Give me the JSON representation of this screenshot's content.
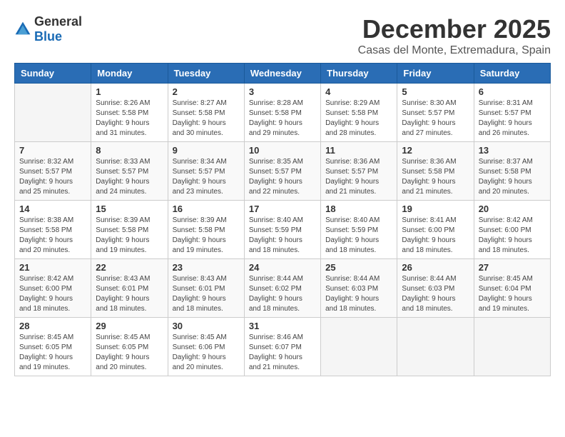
{
  "logo": {
    "general": "General",
    "blue": "Blue"
  },
  "title": "December 2025",
  "subtitle": "Casas del Monte, Extremadura, Spain",
  "headers": [
    "Sunday",
    "Monday",
    "Tuesday",
    "Wednesday",
    "Thursday",
    "Friday",
    "Saturday"
  ],
  "weeks": [
    [
      {
        "day": "",
        "sunrise": "",
        "sunset": "",
        "daylight": ""
      },
      {
        "day": "1",
        "sunrise": "Sunrise: 8:26 AM",
        "sunset": "Sunset: 5:58 PM",
        "daylight": "Daylight: 9 hours and 31 minutes."
      },
      {
        "day": "2",
        "sunrise": "Sunrise: 8:27 AM",
        "sunset": "Sunset: 5:58 PM",
        "daylight": "Daylight: 9 hours and 30 minutes."
      },
      {
        "day": "3",
        "sunrise": "Sunrise: 8:28 AM",
        "sunset": "Sunset: 5:58 PM",
        "daylight": "Daylight: 9 hours and 29 minutes."
      },
      {
        "day": "4",
        "sunrise": "Sunrise: 8:29 AM",
        "sunset": "Sunset: 5:58 PM",
        "daylight": "Daylight: 9 hours and 28 minutes."
      },
      {
        "day": "5",
        "sunrise": "Sunrise: 8:30 AM",
        "sunset": "Sunset: 5:57 PM",
        "daylight": "Daylight: 9 hours and 27 minutes."
      },
      {
        "day": "6",
        "sunrise": "Sunrise: 8:31 AM",
        "sunset": "Sunset: 5:57 PM",
        "daylight": "Daylight: 9 hours and 26 minutes."
      }
    ],
    [
      {
        "day": "7",
        "sunrise": "Sunrise: 8:32 AM",
        "sunset": "Sunset: 5:57 PM",
        "daylight": "Daylight: 9 hours and 25 minutes."
      },
      {
        "day": "8",
        "sunrise": "Sunrise: 8:33 AM",
        "sunset": "Sunset: 5:57 PM",
        "daylight": "Daylight: 9 hours and 24 minutes."
      },
      {
        "day": "9",
        "sunrise": "Sunrise: 8:34 AM",
        "sunset": "Sunset: 5:57 PM",
        "daylight": "Daylight: 9 hours and 23 minutes."
      },
      {
        "day": "10",
        "sunrise": "Sunrise: 8:35 AM",
        "sunset": "Sunset: 5:57 PM",
        "daylight": "Daylight: 9 hours and 22 minutes."
      },
      {
        "day": "11",
        "sunrise": "Sunrise: 8:36 AM",
        "sunset": "Sunset: 5:57 PM",
        "daylight": "Daylight: 9 hours and 21 minutes."
      },
      {
        "day": "12",
        "sunrise": "Sunrise: 8:36 AM",
        "sunset": "Sunset: 5:58 PM",
        "daylight": "Daylight: 9 hours and 21 minutes."
      },
      {
        "day": "13",
        "sunrise": "Sunrise: 8:37 AM",
        "sunset": "Sunset: 5:58 PM",
        "daylight": "Daylight: 9 hours and 20 minutes."
      }
    ],
    [
      {
        "day": "14",
        "sunrise": "Sunrise: 8:38 AM",
        "sunset": "Sunset: 5:58 PM",
        "daylight": "Daylight: 9 hours and 20 minutes."
      },
      {
        "day": "15",
        "sunrise": "Sunrise: 8:39 AM",
        "sunset": "Sunset: 5:58 PM",
        "daylight": "Daylight: 9 hours and 19 minutes."
      },
      {
        "day": "16",
        "sunrise": "Sunrise: 8:39 AM",
        "sunset": "Sunset: 5:58 PM",
        "daylight": "Daylight: 9 hours and 19 minutes."
      },
      {
        "day": "17",
        "sunrise": "Sunrise: 8:40 AM",
        "sunset": "Sunset: 5:59 PM",
        "daylight": "Daylight: 9 hours and 18 minutes."
      },
      {
        "day": "18",
        "sunrise": "Sunrise: 8:40 AM",
        "sunset": "Sunset: 5:59 PM",
        "daylight": "Daylight: 9 hours and 18 minutes."
      },
      {
        "day": "19",
        "sunrise": "Sunrise: 8:41 AM",
        "sunset": "Sunset: 6:00 PM",
        "daylight": "Daylight: 9 hours and 18 minutes."
      },
      {
        "day": "20",
        "sunrise": "Sunrise: 8:42 AM",
        "sunset": "Sunset: 6:00 PM",
        "daylight": "Daylight: 9 hours and 18 minutes."
      }
    ],
    [
      {
        "day": "21",
        "sunrise": "Sunrise: 8:42 AM",
        "sunset": "Sunset: 6:00 PM",
        "daylight": "Daylight: 9 hours and 18 minutes."
      },
      {
        "day": "22",
        "sunrise": "Sunrise: 8:43 AM",
        "sunset": "Sunset: 6:01 PM",
        "daylight": "Daylight: 9 hours and 18 minutes."
      },
      {
        "day": "23",
        "sunrise": "Sunrise: 8:43 AM",
        "sunset": "Sunset: 6:01 PM",
        "daylight": "Daylight: 9 hours and 18 minutes."
      },
      {
        "day": "24",
        "sunrise": "Sunrise: 8:44 AM",
        "sunset": "Sunset: 6:02 PM",
        "daylight": "Daylight: 9 hours and 18 minutes."
      },
      {
        "day": "25",
        "sunrise": "Sunrise: 8:44 AM",
        "sunset": "Sunset: 6:03 PM",
        "daylight": "Daylight: 9 hours and 18 minutes."
      },
      {
        "day": "26",
        "sunrise": "Sunrise: 8:44 AM",
        "sunset": "Sunset: 6:03 PM",
        "daylight": "Daylight: 9 hours and 18 minutes."
      },
      {
        "day": "27",
        "sunrise": "Sunrise: 8:45 AM",
        "sunset": "Sunset: 6:04 PM",
        "daylight": "Daylight: 9 hours and 19 minutes."
      }
    ],
    [
      {
        "day": "28",
        "sunrise": "Sunrise: 8:45 AM",
        "sunset": "Sunset: 6:05 PM",
        "daylight": "Daylight: 9 hours and 19 minutes."
      },
      {
        "day": "29",
        "sunrise": "Sunrise: 8:45 AM",
        "sunset": "Sunset: 6:05 PM",
        "daylight": "Daylight: 9 hours and 20 minutes."
      },
      {
        "day": "30",
        "sunrise": "Sunrise: 8:45 AM",
        "sunset": "Sunset: 6:06 PM",
        "daylight": "Daylight: 9 hours and 20 minutes."
      },
      {
        "day": "31",
        "sunrise": "Sunrise: 8:46 AM",
        "sunset": "Sunset: 6:07 PM",
        "daylight": "Daylight: 9 hours and 21 minutes."
      },
      {
        "day": "",
        "sunrise": "",
        "sunset": "",
        "daylight": ""
      },
      {
        "day": "",
        "sunrise": "",
        "sunset": "",
        "daylight": ""
      },
      {
        "day": "",
        "sunrise": "",
        "sunset": "",
        "daylight": ""
      }
    ]
  ]
}
